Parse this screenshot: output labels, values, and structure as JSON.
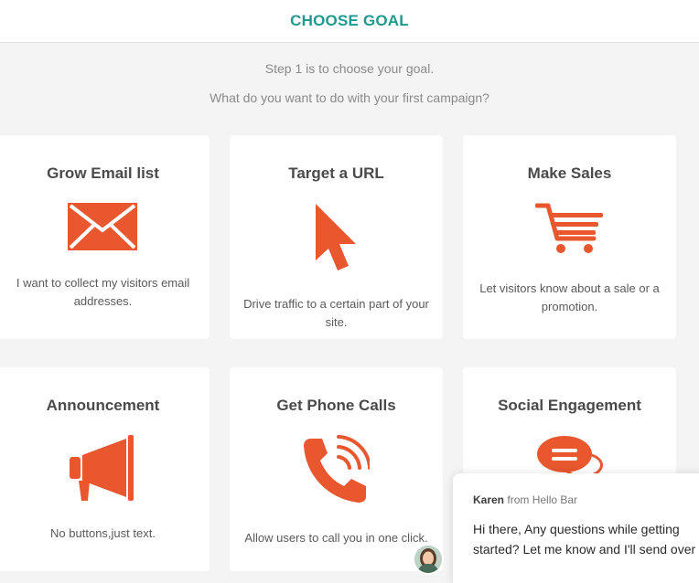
{
  "header": {
    "title": "CHOOSE GOAL"
  },
  "intro": {
    "step": "Step 1 is to choose your goal.",
    "question": "What do you want to do with your first campaign?"
  },
  "cards": [
    {
      "title": "Grow Email list",
      "description": "I want to collect my visitors email addresses.",
      "icon": "envelope-icon"
    },
    {
      "title": "Target a URL",
      "description": "Drive traffic to a certain part of your site.",
      "icon": "cursor-arrow-icon"
    },
    {
      "title": "Make Sales",
      "description": "Let visitors know about a sale or a promotion.",
      "icon": "shopping-cart-icon"
    },
    {
      "title": "Announcement",
      "description": "No buttons,just text.",
      "icon": "megaphone-icon"
    },
    {
      "title": "Get Phone Calls",
      "description": "Allow users to call you in one click.",
      "icon": "phone-icon"
    },
    {
      "title": "Social Engagement",
      "description": "",
      "icon": "chat-bubbles-icon"
    }
  ],
  "chat": {
    "agent_name": "Karen",
    "from_suffix": "from Hello Bar",
    "message": "Hi there, Any questions while getting started?  Let me know and I'll send over",
    "avatar_icon": "agent-avatar"
  },
  "colors": {
    "accent": "#1f9a8e",
    "icon": "#e8572e"
  }
}
